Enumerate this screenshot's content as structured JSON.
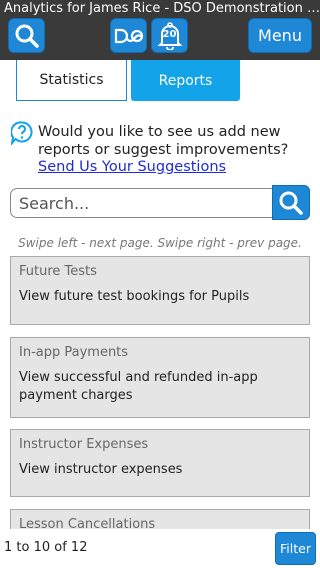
{
  "header": {
    "title": "Analytics for James Rice - DSO Demonstration Academy",
    "logo_text": "DSO",
    "notification_count": "20",
    "menu_label": "Menu"
  },
  "tabs": [
    {
      "label": "Statistics",
      "active": false
    },
    {
      "label": "Reports",
      "active": true
    }
  ],
  "suggestion": {
    "text": "Would you like to see us add new reports or suggest improvements?",
    "link": "Send Us Your Suggestions"
  },
  "search": {
    "placeholder": "Search..."
  },
  "swipe_hint": "Swipe left - next page. Swipe right - prev page.",
  "reports": [
    {
      "title": "Future Tests",
      "description": "View future test bookings for Pupils"
    },
    {
      "title": "In-app Payments",
      "description": "View successful and refunded in-app payment charges"
    },
    {
      "title": "Instructor Expenses",
      "description": "View instructor expenses"
    },
    {
      "title": "Lesson Cancellations",
      "description": ""
    }
  ],
  "footer": {
    "pagination": "1 to 10 of 12",
    "filter_label": "Filter"
  },
  "colors": {
    "header_bg": "#3a3a3a",
    "button_blue": "#1e88d6",
    "active_tab": "#13a3e8",
    "link": "#1e2bd6",
    "card_bg": "#e5e5e5"
  }
}
